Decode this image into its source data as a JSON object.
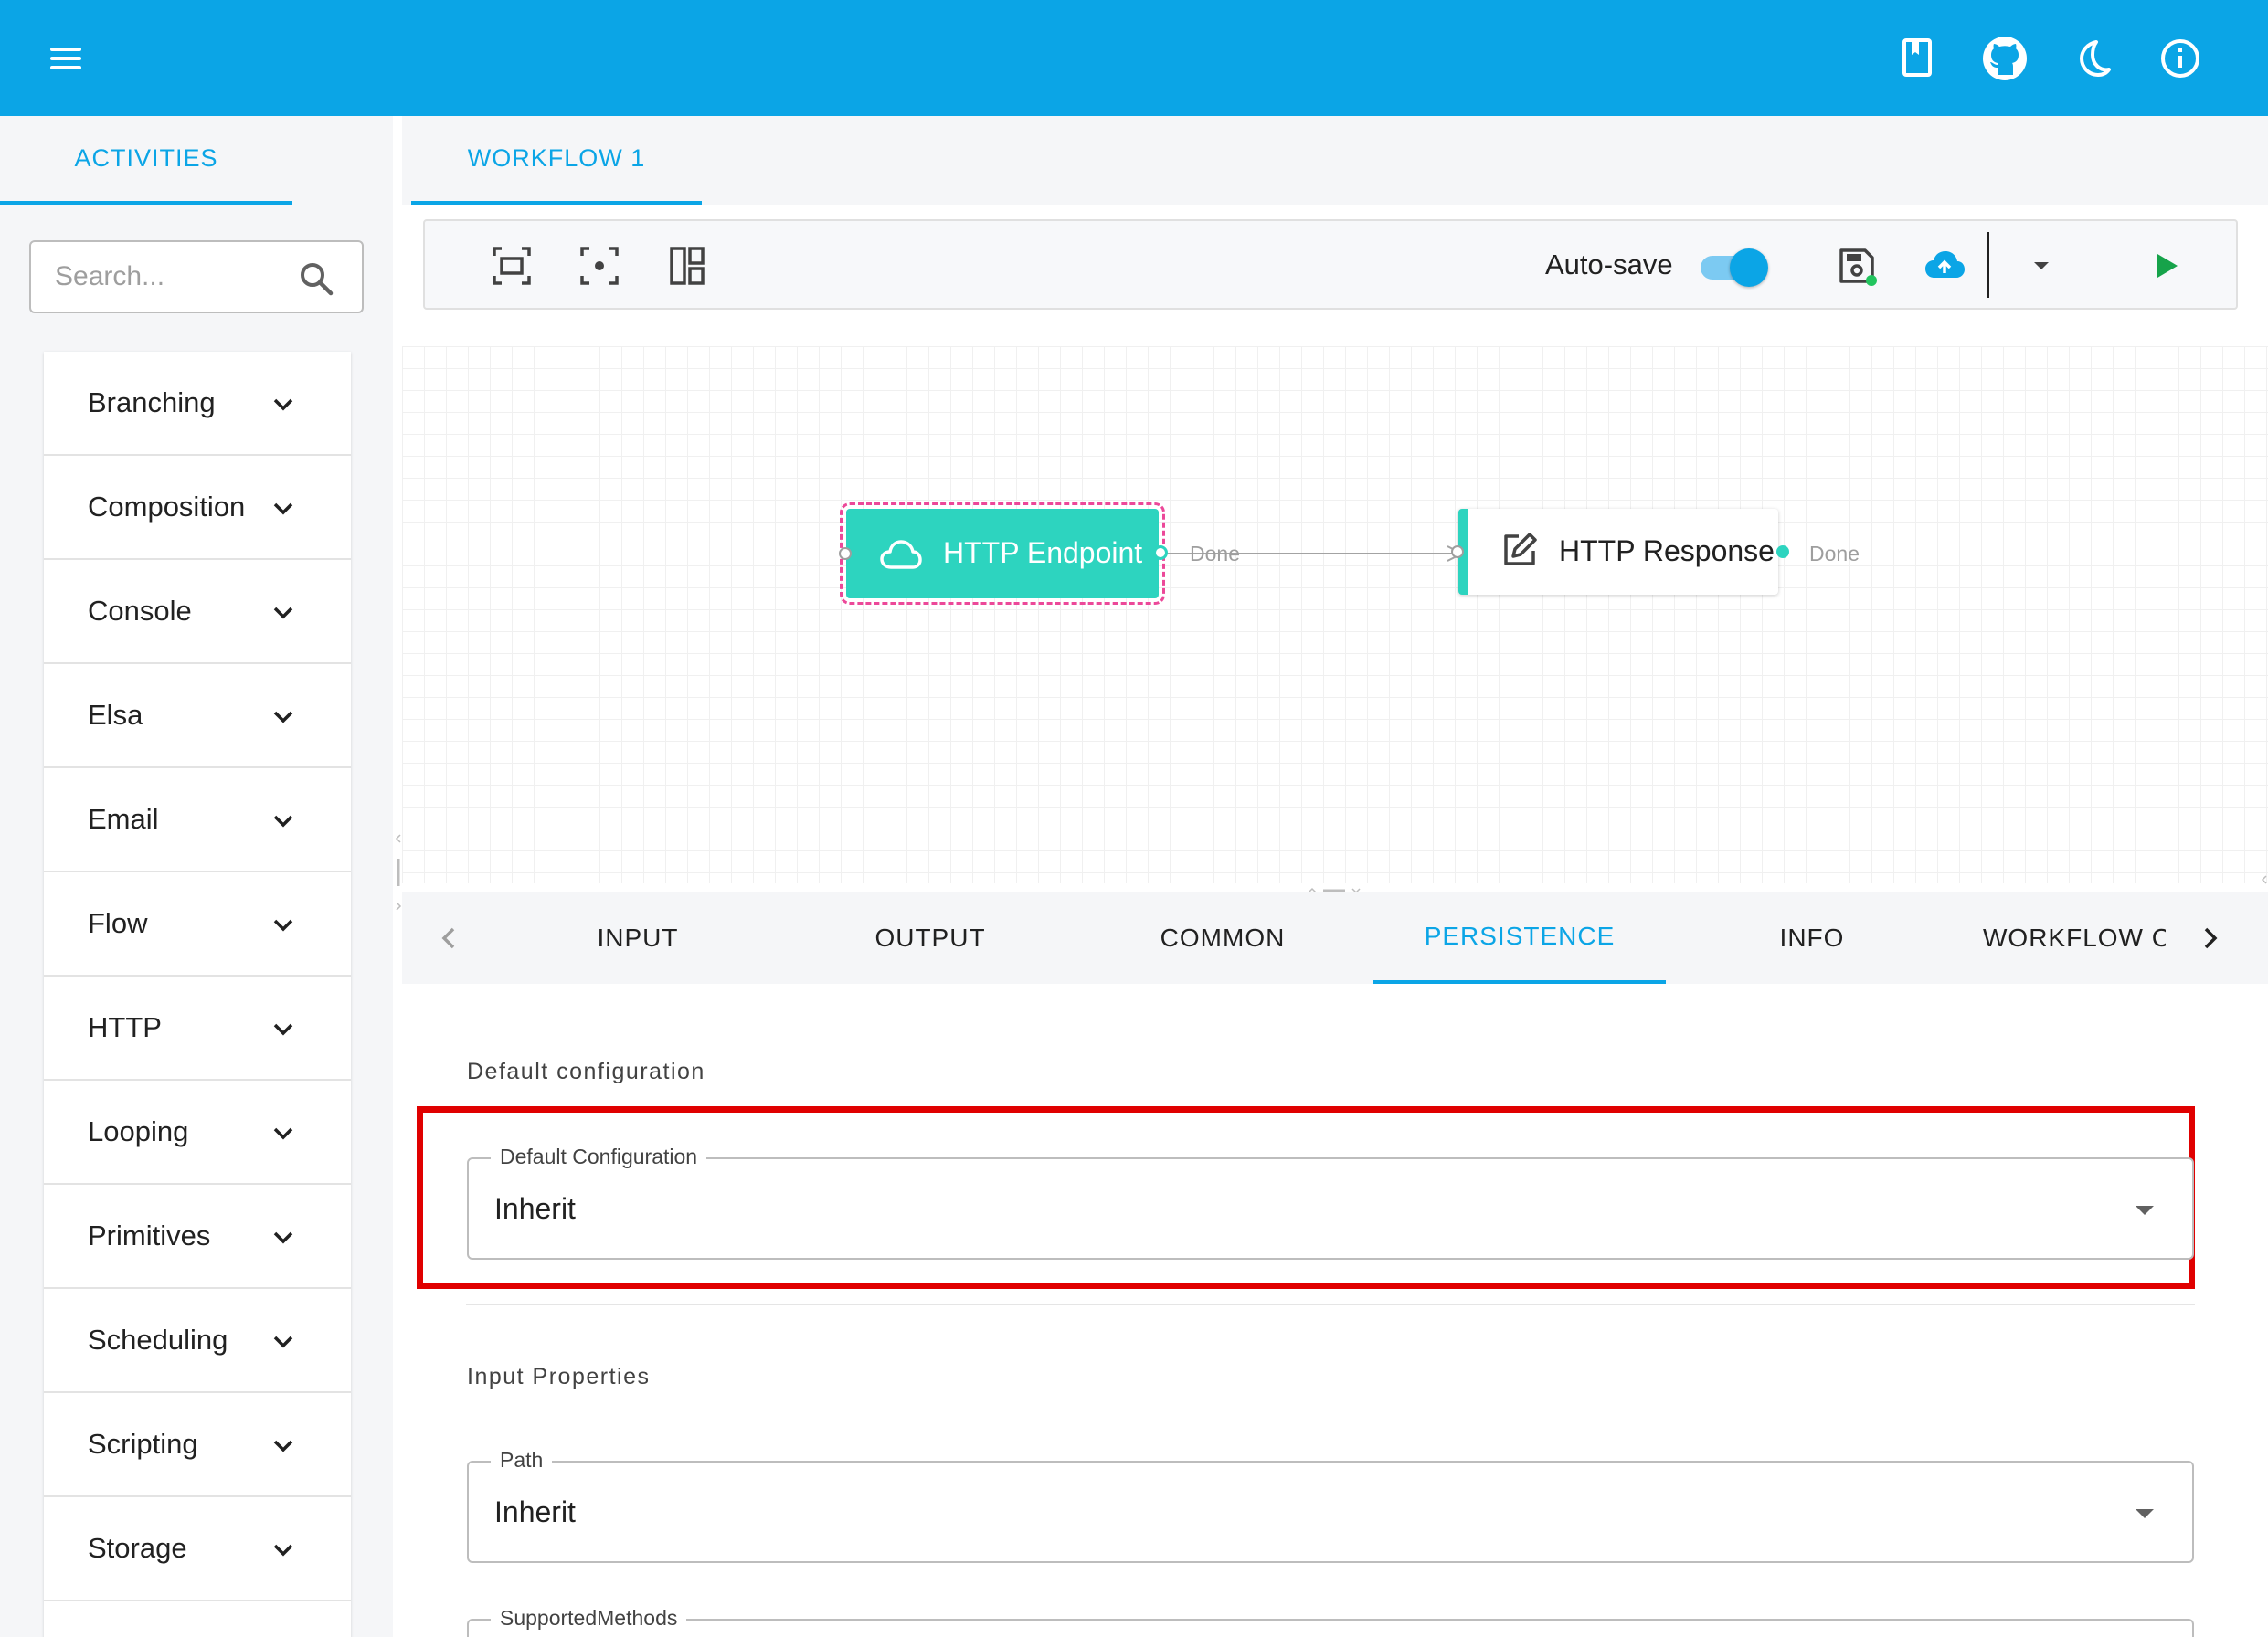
{
  "header": {
    "menu_icon": "hamburger-menu-icon",
    "actions": [
      {
        "name": "docs-book-icon"
      },
      {
        "name": "github-icon"
      },
      {
        "name": "dark-mode-moon-icon"
      },
      {
        "name": "info-icon"
      }
    ],
    "bar_color": "#0ba5e6"
  },
  "left_panel": {
    "tab_label": "ACTIVITIES",
    "search": {
      "placeholder": "Search...",
      "value": ""
    },
    "categories": [
      {
        "label": "Branching"
      },
      {
        "label": "Composition"
      },
      {
        "label": "Console"
      },
      {
        "label": "Elsa"
      },
      {
        "label": "Email"
      },
      {
        "label": "Flow"
      },
      {
        "label": "HTTP"
      },
      {
        "label": "Looping"
      },
      {
        "label": "Primitives"
      },
      {
        "label": "Scheduling"
      },
      {
        "label": "Scripting"
      },
      {
        "label": "Storage"
      }
    ]
  },
  "workflow": {
    "tab_label": "WORKFLOW 1",
    "toolbar": {
      "zoom_to_fit_icon": "zoom-to-fit-icon",
      "center_icon": "center-focus-icon",
      "auto_layout_icon": "auto-layout-icon",
      "autosave_label": "Auto-save",
      "autosave_on": true,
      "save_icon": "save-icon",
      "publish_icon": "cloud-upload-icon",
      "more_icon": "dropdown-arrow-icon",
      "run_icon": "play-icon"
    },
    "nodes": [
      {
        "label": "HTTP Endpoint",
        "icon": "cloud-icon",
        "outcome": "Done",
        "selected": true
      },
      {
        "label": "HTTP Response",
        "icon": "edit-icon",
        "outcome": "Done",
        "selected": false
      }
    ],
    "accent_color": "#2dd4bf",
    "selection_color": "#ec4899"
  },
  "properties": {
    "tabs": [
      {
        "label": "INPUT",
        "active": false
      },
      {
        "label": "OUTPUT",
        "active": false
      },
      {
        "label": "COMMON",
        "active": false
      },
      {
        "label": "PERSISTENCE",
        "active": true
      },
      {
        "label": "INFO",
        "active": false
      },
      {
        "label": "WORKFLOW CO",
        "active": false
      }
    ],
    "default_section": {
      "title": "Default configuration",
      "field_label": "Default Configuration",
      "field_value": "Inherit"
    },
    "input_section": {
      "title": "Input Properties",
      "fields": [
        {
          "label": "Path",
          "value": "Inherit"
        },
        {
          "label": "SupportedMethods",
          "value": ""
        }
      ]
    },
    "highlight_color": "#e00000"
  }
}
